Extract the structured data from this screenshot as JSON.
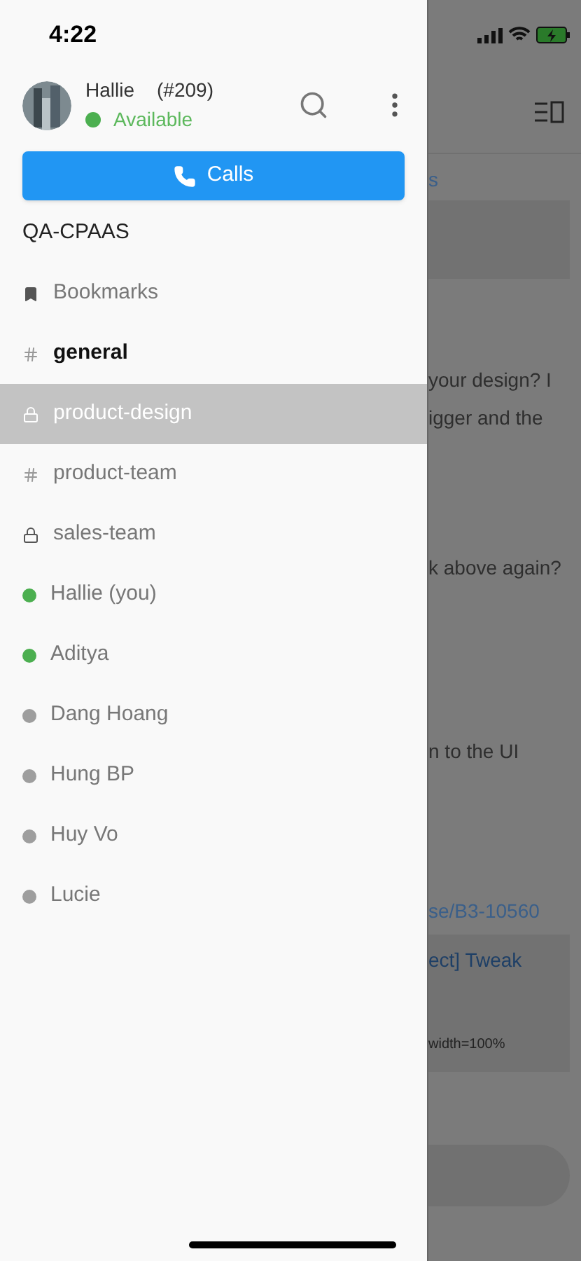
{
  "status_bar": {
    "time": "4:22"
  },
  "user": {
    "name": "Hallie",
    "number": "(#209)",
    "status": "Available",
    "online": true
  },
  "calls_button": {
    "label": "Calls"
  },
  "workspace": {
    "title": "QA-CPAAS"
  },
  "items": [
    {
      "kind": "bookmark",
      "label": "Bookmarks",
      "selected": false,
      "unread": false
    },
    {
      "kind": "public",
      "label": "general",
      "selected": false,
      "unread": true
    },
    {
      "kind": "private",
      "label": "product-design",
      "selected": true,
      "unread": false
    },
    {
      "kind": "public",
      "label": "product-team",
      "selected": false,
      "unread": false
    },
    {
      "kind": "private",
      "label": "sales-team",
      "selected": false,
      "unread": false
    },
    {
      "kind": "user",
      "label": "Hallie (you)",
      "selected": false,
      "unread": false,
      "color": "#4caf50"
    },
    {
      "kind": "user",
      "label": "Aditya",
      "selected": false,
      "unread": false,
      "color": "#4caf50"
    },
    {
      "kind": "user",
      "label": "Dang Hoang",
      "selected": false,
      "unread": false,
      "color": "#9e9e9e"
    },
    {
      "kind": "user",
      "label": "Hung BP",
      "selected": false,
      "unread": false,
      "color": "#9e9e9e"
    },
    {
      "kind": "user",
      "label": "Huy Vo",
      "selected": false,
      "unread": false,
      "color": "#9e9e9e"
    },
    {
      "kind": "user",
      "label": "Lucie",
      "selected": false,
      "unread": false,
      "color": "#9e9e9e"
    }
  ],
  "background": {
    "link_top": "s",
    "message_lines": [
      "your design? I",
      "igger and the",
      "k above again?",
      "n to the UI"
    ],
    "link_bottom": "se/B3-10560",
    "preview_title": "ect] Tweak",
    "preview_text": "width=100%"
  }
}
